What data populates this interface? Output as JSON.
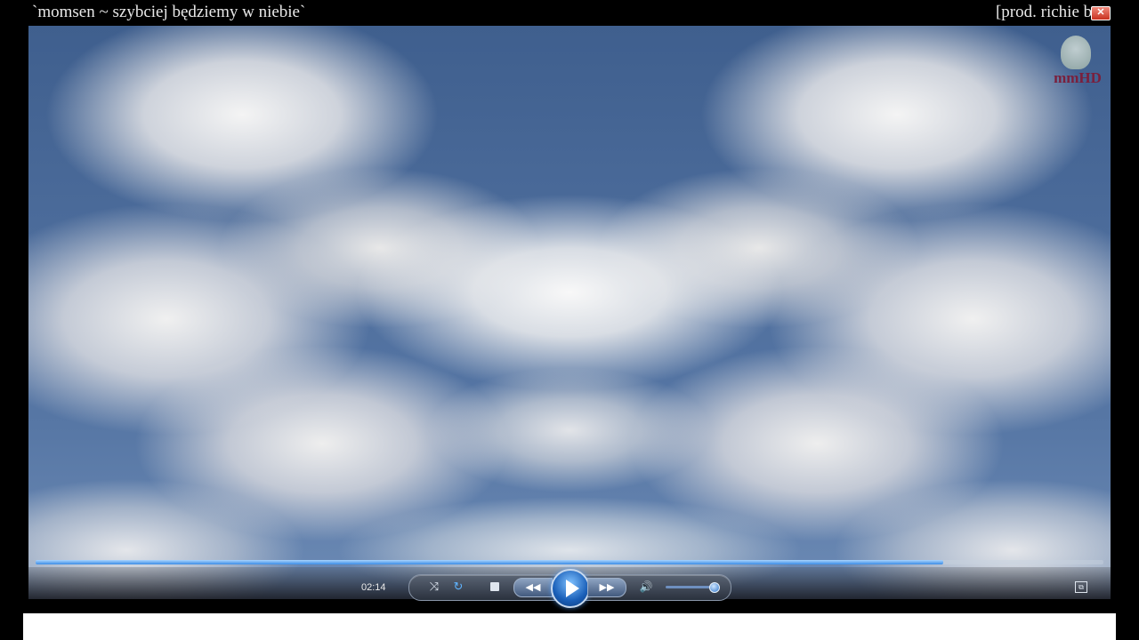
{
  "window": {
    "title_left": "`momsen ~ szybciej będziemy w niebie`",
    "title_right": "[prod. richie bea",
    "close_glyph": "✕"
  },
  "overlay": {
    "logo_text": "mmHD"
  },
  "player": {
    "elapsed_time": "02:14",
    "progress": 0.85,
    "volume": 0.9,
    "icons": {
      "shuffle": "⤨",
      "repeat": "↻",
      "rewind": "◀◀",
      "forward": "▶▶",
      "volume": "🔊",
      "switch_view": "⧉"
    }
  },
  "colors": {
    "accent": "#3c8ce6",
    "title_text": "#e8e8e8",
    "logo": "#7a1f3c"
  }
}
